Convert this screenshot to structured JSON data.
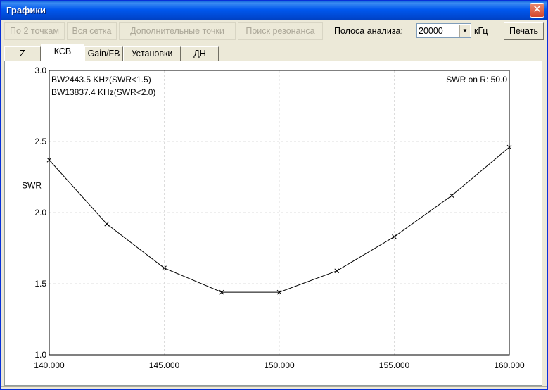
{
  "window": {
    "title": "Графики",
    "close_glyph": "✕"
  },
  "toolbar": {
    "buttons": [
      {
        "label": "По 2 точкам",
        "enabled": false
      },
      {
        "label": "Вся сетка",
        "enabled": false
      },
      {
        "label": "Дополнительные точки",
        "enabled": false
      },
      {
        "label": "Поиск резонанса",
        "enabled": false
      }
    ],
    "band_label": "Полоса анализа:",
    "band_value": "20000",
    "band_unit": "кГц",
    "print_label": "Печать"
  },
  "tabs": [
    {
      "label": "Z",
      "active": false
    },
    {
      "label": "КСВ",
      "active": true
    },
    {
      "label": "Gain/FB",
      "active": false
    },
    {
      "label": "Установки",
      "active": false
    },
    {
      "label": "ДН",
      "active": false
    }
  ],
  "chart_data": {
    "type": "line",
    "title": "",
    "xlabel": "",
    "ylabel": "SWR",
    "xlim": [
      140,
      160
    ],
    "ylim": [
      1.0,
      3.0
    ],
    "x_ticks": [
      "140.000",
      "145.000",
      "150.000",
      "155.000",
      "160.000"
    ],
    "y_ticks": [
      "1.0",
      "1.5",
      "2.0",
      "2.5",
      "3.0"
    ],
    "grid": true,
    "annotations": [
      "BW2443.5 KHz(SWR<1.5)",
      "BW13837.4 KHz(SWR<2.0)",
      "SWR on R: 50.0"
    ],
    "x": [
      140.0,
      142.5,
      145.0,
      147.5,
      150.0,
      152.5,
      155.0,
      157.5,
      160.0
    ],
    "values": [
      2.37,
      1.92,
      1.61,
      1.44,
      1.44,
      1.59,
      1.83,
      2.12,
      2.46
    ],
    "line_color": "#000000",
    "marker": "x"
  }
}
